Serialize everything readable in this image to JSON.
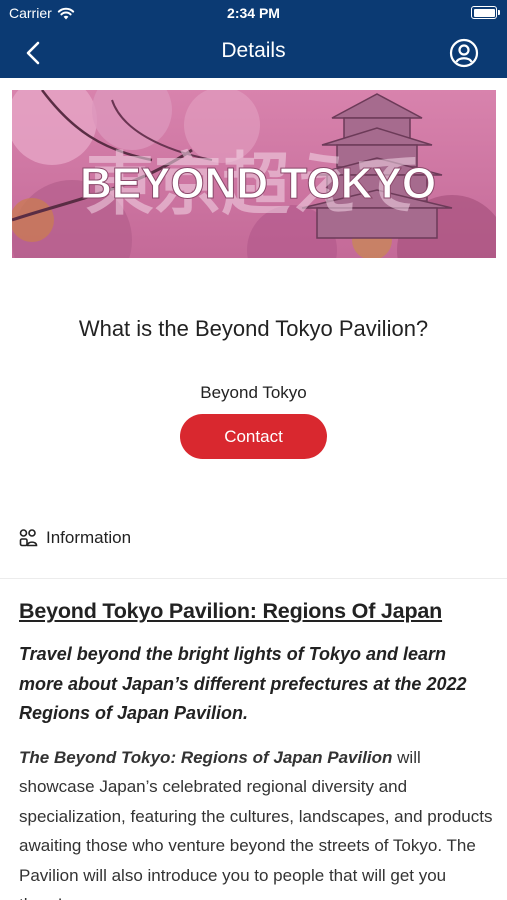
{
  "status_bar": {
    "carrier": "Carrier",
    "time": "2:34 PM",
    "icons": [
      "wifi-icon",
      "battery-icon"
    ]
  },
  "nav": {
    "title": "Details",
    "back_icon": "chevron-left-icon",
    "profile_icon": "user-circle-icon"
  },
  "banner": {
    "text": "BEYOND TOKYO",
    "kanji": "東京超えて"
  },
  "header": {
    "title": "What is the Beyond Tokyo Pavilion?",
    "subtitle": "Beyond Tokyo",
    "contact_label": "Contact"
  },
  "section": {
    "icon": "people-icon",
    "label": "Information"
  },
  "article": {
    "heading": "Beyond Tokyo Pavilion: Regions Of Japan",
    "lead": "Travel beyond the bright lights of Tokyo and learn more about Japan’s different prefectures at the 2022 Regions of Japan Pavilion.",
    "body_emphasis": "The Beyond Tokyo: Regions of Japan Pavilion",
    "body_rest": " will showcase Japan’s celebrated regional diversity and specialization, featuring the cultures, landscapes, and products awaiting those who venture beyond the streets of Tokyo. The Pavilion will also introduce you to people that will get you there!"
  },
  "colors": {
    "navbar": "#0b3a73",
    "accent_red": "#d9282f",
    "banner_pink": "#c9709a"
  }
}
